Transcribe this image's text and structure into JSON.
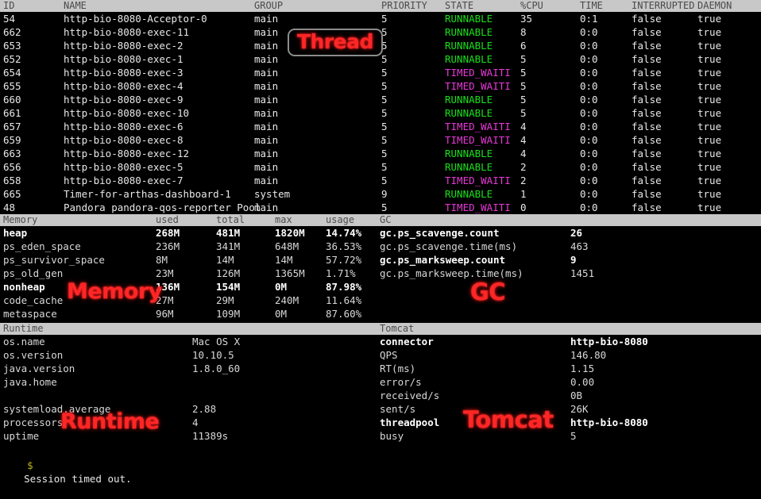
{
  "thread_section": {
    "headers": {
      "id": "ID",
      "name": "NAME",
      "group": "GROUP",
      "priority": "PRIORITY",
      "state": "STATE",
      "cpu": "%CPU",
      "time": "TIME",
      "interrupted": "INTERRUPTED",
      "daemon": "DAEMON"
    },
    "rows": [
      {
        "id": "54",
        "name": "http-bio-8080-Acceptor-0",
        "group": "main",
        "priority": "5",
        "state": "RUNNABLE",
        "cpu": "35",
        "time": "0:1",
        "interrupted": "false",
        "daemon": "true"
      },
      {
        "id": "662",
        "name": "http-bio-8080-exec-11",
        "group": "main",
        "priority": "5",
        "state": "RUNNABLE",
        "cpu": "8",
        "time": "0:0",
        "interrupted": "false",
        "daemon": "true"
      },
      {
        "id": "653",
        "name": "http-bio-8080-exec-2",
        "group": "main",
        "priority": "5",
        "state": "RUNNABLE",
        "cpu": "6",
        "time": "0:0",
        "interrupted": "false",
        "daemon": "true"
      },
      {
        "id": "652",
        "name": "http-bio-8080-exec-1",
        "group": "main",
        "priority": "5",
        "state": "RUNNABLE",
        "cpu": "5",
        "time": "0:0",
        "interrupted": "false",
        "daemon": "true"
      },
      {
        "id": "654",
        "name": "http-bio-8080-exec-3",
        "group": "main",
        "priority": "5",
        "state": "TIMED_WAITI",
        "cpu": "5",
        "time": "0:0",
        "interrupted": "false",
        "daemon": "true"
      },
      {
        "id": "655",
        "name": "http-bio-8080-exec-4",
        "group": "main",
        "priority": "5",
        "state": "TIMED_WAITI",
        "cpu": "5",
        "time": "0:0",
        "interrupted": "false",
        "daemon": "true"
      },
      {
        "id": "660",
        "name": "http-bio-8080-exec-9",
        "group": "main",
        "priority": "5",
        "state": "RUNNABLE",
        "cpu": "5",
        "time": "0:0",
        "interrupted": "false",
        "daemon": "true"
      },
      {
        "id": "661",
        "name": "http-bio-8080-exec-10",
        "group": "main",
        "priority": "5",
        "state": "RUNNABLE",
        "cpu": "5",
        "time": "0:0",
        "interrupted": "false",
        "daemon": "true"
      },
      {
        "id": "657",
        "name": "http-bio-8080-exec-6",
        "group": "main",
        "priority": "5",
        "state": "TIMED_WAITI",
        "cpu": "4",
        "time": "0:0",
        "interrupted": "false",
        "daemon": "true"
      },
      {
        "id": "659",
        "name": "http-bio-8080-exec-8",
        "group": "main",
        "priority": "5",
        "state": "TIMED_WAITI",
        "cpu": "4",
        "time": "0:0",
        "interrupted": "false",
        "daemon": "true"
      },
      {
        "id": "663",
        "name": "http-bio-8080-exec-12",
        "group": "main",
        "priority": "5",
        "state": "RUNNABLE",
        "cpu": "4",
        "time": "0:0",
        "interrupted": "false",
        "daemon": "true"
      },
      {
        "id": "656",
        "name": "http-bio-8080-exec-5",
        "group": "main",
        "priority": "5",
        "state": "RUNNABLE",
        "cpu": "2",
        "time": "0:0",
        "interrupted": "false",
        "daemon": "true"
      },
      {
        "id": "658",
        "name": "http-bio-8080-exec-7",
        "group": "main",
        "priority": "5",
        "state": "TIMED_WAITI",
        "cpu": "2",
        "time": "0:0",
        "interrupted": "false",
        "daemon": "true"
      },
      {
        "id": "665",
        "name": "Timer-for-arthas-dashboard-1",
        "group": "system",
        "priority": "9",
        "state": "RUNNABLE",
        "cpu": "1",
        "time": "0:0",
        "interrupted": "false",
        "daemon": "true"
      },
      {
        "id": "48",
        "name": "Pandora pandora-qos-reporter Pool",
        "group": "main",
        "priority": "5",
        "state": "TIMED_WAITI",
        "cpu": "0",
        "time": "0:0",
        "interrupted": "false",
        "daemon": "true"
      }
    ]
  },
  "memory_section": {
    "headers": {
      "title": "Memory",
      "used": "used",
      "total": "total",
      "max": "max",
      "usage": "usage"
    },
    "rows": [
      {
        "name": "heap",
        "used": "268M",
        "total": "481M",
        "max": "1820M",
        "usage": "14.74%",
        "bold": true
      },
      {
        "name": "ps_eden_space",
        "used": "236M",
        "total": "341M",
        "max": "648M",
        "usage": "36.53%",
        "bold": false
      },
      {
        "name": "ps_survivor_space",
        "used": "8M",
        "total": "14M",
        "max": "14M",
        "usage": "57.72%",
        "bold": false
      },
      {
        "name": "ps_old_gen",
        "used": "23M",
        "total": "126M",
        "max": "1365M",
        "usage": "1.71%",
        "bold": false
      },
      {
        "name": "nonheap",
        "used": "136M",
        "total": "154M",
        "max": "0M",
        "usage": "87.98%",
        "bold": true
      },
      {
        "name": "code_cache",
        "used": "27M",
        "total": "29M",
        "max": "240M",
        "usage": "11.64%",
        "bold": false
      },
      {
        "name": "metaspace",
        "used": "96M",
        "total": "109M",
        "max": "0M",
        "usage": "87.60%",
        "bold": false
      }
    ]
  },
  "gc_section": {
    "title": "GC",
    "rows": [
      {
        "name": "gc.ps_scavenge.count",
        "value": "26",
        "bold": true
      },
      {
        "name": "gc.ps_scavenge.time(ms)",
        "value": "463",
        "bold": false
      },
      {
        "name": "gc.ps_marksweep.count",
        "value": "9",
        "bold": true
      },
      {
        "name": "gc.ps_marksweep.time(ms)",
        "value": "1451",
        "bold": false
      }
    ]
  },
  "runtime_section": {
    "title": "Runtime",
    "rows": [
      {
        "name": "os.name",
        "value": "Mac OS X"
      },
      {
        "name": "os.version",
        "value": "10.10.5"
      },
      {
        "name": "java.version",
        "value": "1.8.0_60"
      },
      {
        "name": "java.home",
        "value": ""
      },
      {
        "name": "",
        "value": ""
      },
      {
        "name": "systemload.average",
        "value": "2.88"
      },
      {
        "name": "processors",
        "value": "4"
      },
      {
        "name": "uptime",
        "value": "11389s"
      }
    ]
  },
  "tomcat_section": {
    "title": "Tomcat",
    "rows": [
      {
        "name": "connector",
        "value": "http-bio-8080",
        "bold": true
      },
      {
        "name": "QPS",
        "value": "146.80",
        "bold": false
      },
      {
        "name": "RT(ms)",
        "value": "1.15",
        "bold": false
      },
      {
        "name": "error/s",
        "value": "0.00",
        "bold": false
      },
      {
        "name": "received/s",
        "value": "0B",
        "bold": false
      },
      {
        "name": "sent/s",
        "value": "26K",
        "bold": false
      },
      {
        "name": "threadpool",
        "value": "http-bio-8080",
        "bold": true
      },
      {
        "name": "busy",
        "value": "5",
        "bold": false
      }
    ]
  },
  "prompt": {
    "sigil": "$",
    "message": "Session timed out."
  },
  "annotations": {
    "thread": "Thread",
    "memory": "Memory",
    "gc": "GC",
    "runtime": "Runtime",
    "tomcat": "Tomcat",
    "color": "#ff2626"
  }
}
